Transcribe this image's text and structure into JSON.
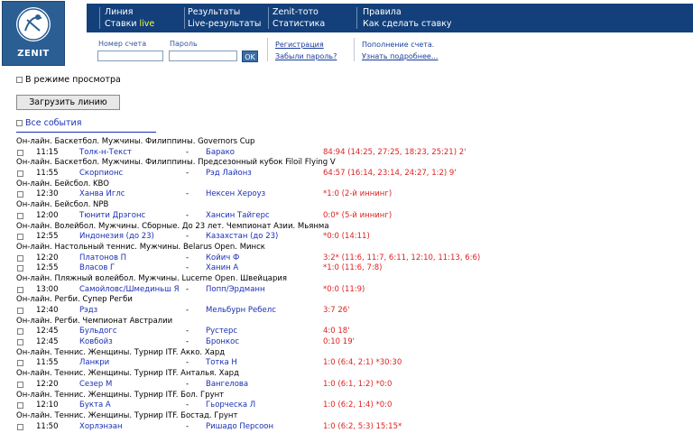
{
  "brand": {
    "logo_text": "ZENIT"
  },
  "nav": [
    {
      "line1": "Линия",
      "line2_prefix": "Ставки ",
      "line2_highlight": "live"
    },
    {
      "line1": "Результаты",
      "line2_prefix": "Live-результаты",
      "line2_highlight": ""
    },
    {
      "line1": "Zenit-тото",
      "line2_prefix": "Статистика",
      "line2_highlight": ""
    },
    {
      "line1": "Правила",
      "line2_prefix": "Как сделать ставку",
      "line2_highlight": ""
    }
  ],
  "login": {
    "account_label": "Номер счета",
    "account_value": "",
    "password_label": "Пароль",
    "password_value": "",
    "ok_label": "OK",
    "register_link": "Регистрация",
    "forgot_link": "Забыли пароль?",
    "topup_text": "Пополнение счета.",
    "learn_more_link": "Узнать подробнее..."
  },
  "preview_mode_label": "В режиме просмотра",
  "load_button_label": "Загрузить линию",
  "all_events_label": "Все события",
  "colors": {
    "nav_bg": "#13407a",
    "live": "#f7ff3c",
    "link": "#1a2fb4",
    "score": "#e02020",
    "logo_bg": "#2b5f93"
  },
  "categories": [
    {
      "title": "Он-лайн. Баскетбол. Мужчины. Филиппины. Governors Cup",
      "events": [
        {
          "time": "11:15",
          "home": "Толк-н-Текст",
          "away": "Барако",
          "score": "84:94 (14:25, 27:25, 18:23, 25:21) 2'"
        }
      ]
    },
    {
      "title": "Он-лайн. Баскетбол. Мужчины. Филиппины. Предсезонный кубок Filoil Flying V",
      "events": [
        {
          "time": "11:55",
          "home": "Скорпионс",
          "away": "Рэд Лайонз",
          "score": "64:57 (16:14, 23:14, 24:27, 1:2) 9'"
        }
      ]
    },
    {
      "title": "Он-лайн. Бейсбол. KBO",
      "events": [
        {
          "time": "12:30",
          "home": "Ханва Иглс",
          "away": "Нексен Хероуз",
          "score": "*1:0 (2-й иннинг)"
        }
      ]
    },
    {
      "title": "Он-лайн. Бейсбол. NPB",
      "events": [
        {
          "time": "12:00",
          "home": "Тюнити Дрэгонс",
          "away": "Хансин Тайгерс",
          "score": "0:0* (5-й иннинг)"
        }
      ]
    },
    {
      "title": "Он-лайн. Волейбол. Мужчины. Сборные. До 23 лет. Чемпионат Азии. Мьянма",
      "events": [
        {
          "time": "12:55",
          "home": "Индонезия (до 23)",
          "away": "Казахстан (до 23)",
          "score": "*0:0 (14:11)"
        }
      ]
    },
    {
      "title": "Он-лайн. Настольный теннис. Мужчины. Belarus Open. Минск",
      "events": [
        {
          "time": "12:20",
          "home": "Платонов П",
          "away": "Койич Ф",
          "score": "3:2* (11:6, 11:7, 6:11, 12:10, 11:13, 6:6)"
        },
        {
          "time": "12:55",
          "home": "Власов Г",
          "away": "Ханин А",
          "score": "*1:0 (11:6, 7:8)"
        }
      ]
    },
    {
      "title": "Он-лайн. Пляжный волейбол. Мужчины. Lucerne Open. Швейцария",
      "events": [
        {
          "time": "13:00",
          "home": "Самойловс/Шмединьш Я",
          "away": "Попп/Эрдманн",
          "score": "*0:0 (11:9)"
        }
      ]
    },
    {
      "title": "Он-лайн. Регби. Супер Регби",
      "events": [
        {
          "time": "12:40",
          "home": "Рэдз",
          "away": "Мельбурн Ребелс",
          "score": "3:7 26'"
        }
      ]
    },
    {
      "title": "Он-лайн. Регби. Чемпионат Австралии",
      "events": [
        {
          "time": "12:45",
          "home": "Бульдогс",
          "away": "Рустерс",
          "score": "4:0 18'"
        },
        {
          "time": "12:45",
          "home": "Ковбойз",
          "away": "Бронкос",
          "score": "0:10 19'"
        }
      ]
    },
    {
      "title": "Он-лайн. Теннис. Женщины. Турнир ITF. Акко. Хард",
      "events": [
        {
          "time": "11:55",
          "home": "Ланкри",
          "away": "Тотка Н",
          "score": "1:0 (6:4, 2:1) *30:30"
        }
      ]
    },
    {
      "title": "Он-лайн. Теннис. Женщины. Турнир ITF. Анталья. Хард",
      "events": [
        {
          "time": "12:20",
          "home": "Сезер М",
          "away": "Вангелова",
          "score": "1:0 (6:1, 1:2) *0:0"
        }
      ]
    },
    {
      "title": "Он-лайн. Теннис. Женщины. Турнир ITF. Бол. Грунт",
      "events": [
        {
          "time": "12:10",
          "home": "Букта А",
          "away": "Гьорческа Л",
          "score": "1:0 (6:2, 1:4) *0:0"
        }
      ]
    },
    {
      "title": "Он-лайн. Теннис. Женщины. Турнир ITF. Бостад. Грунт",
      "events": [
        {
          "time": "11:50",
          "home": "Хорлэнэан",
          "away": "Ришадо Персоон",
          "score": "1:0 (6:2, 5:3) 15:15*"
        }
      ]
    }
  ]
}
